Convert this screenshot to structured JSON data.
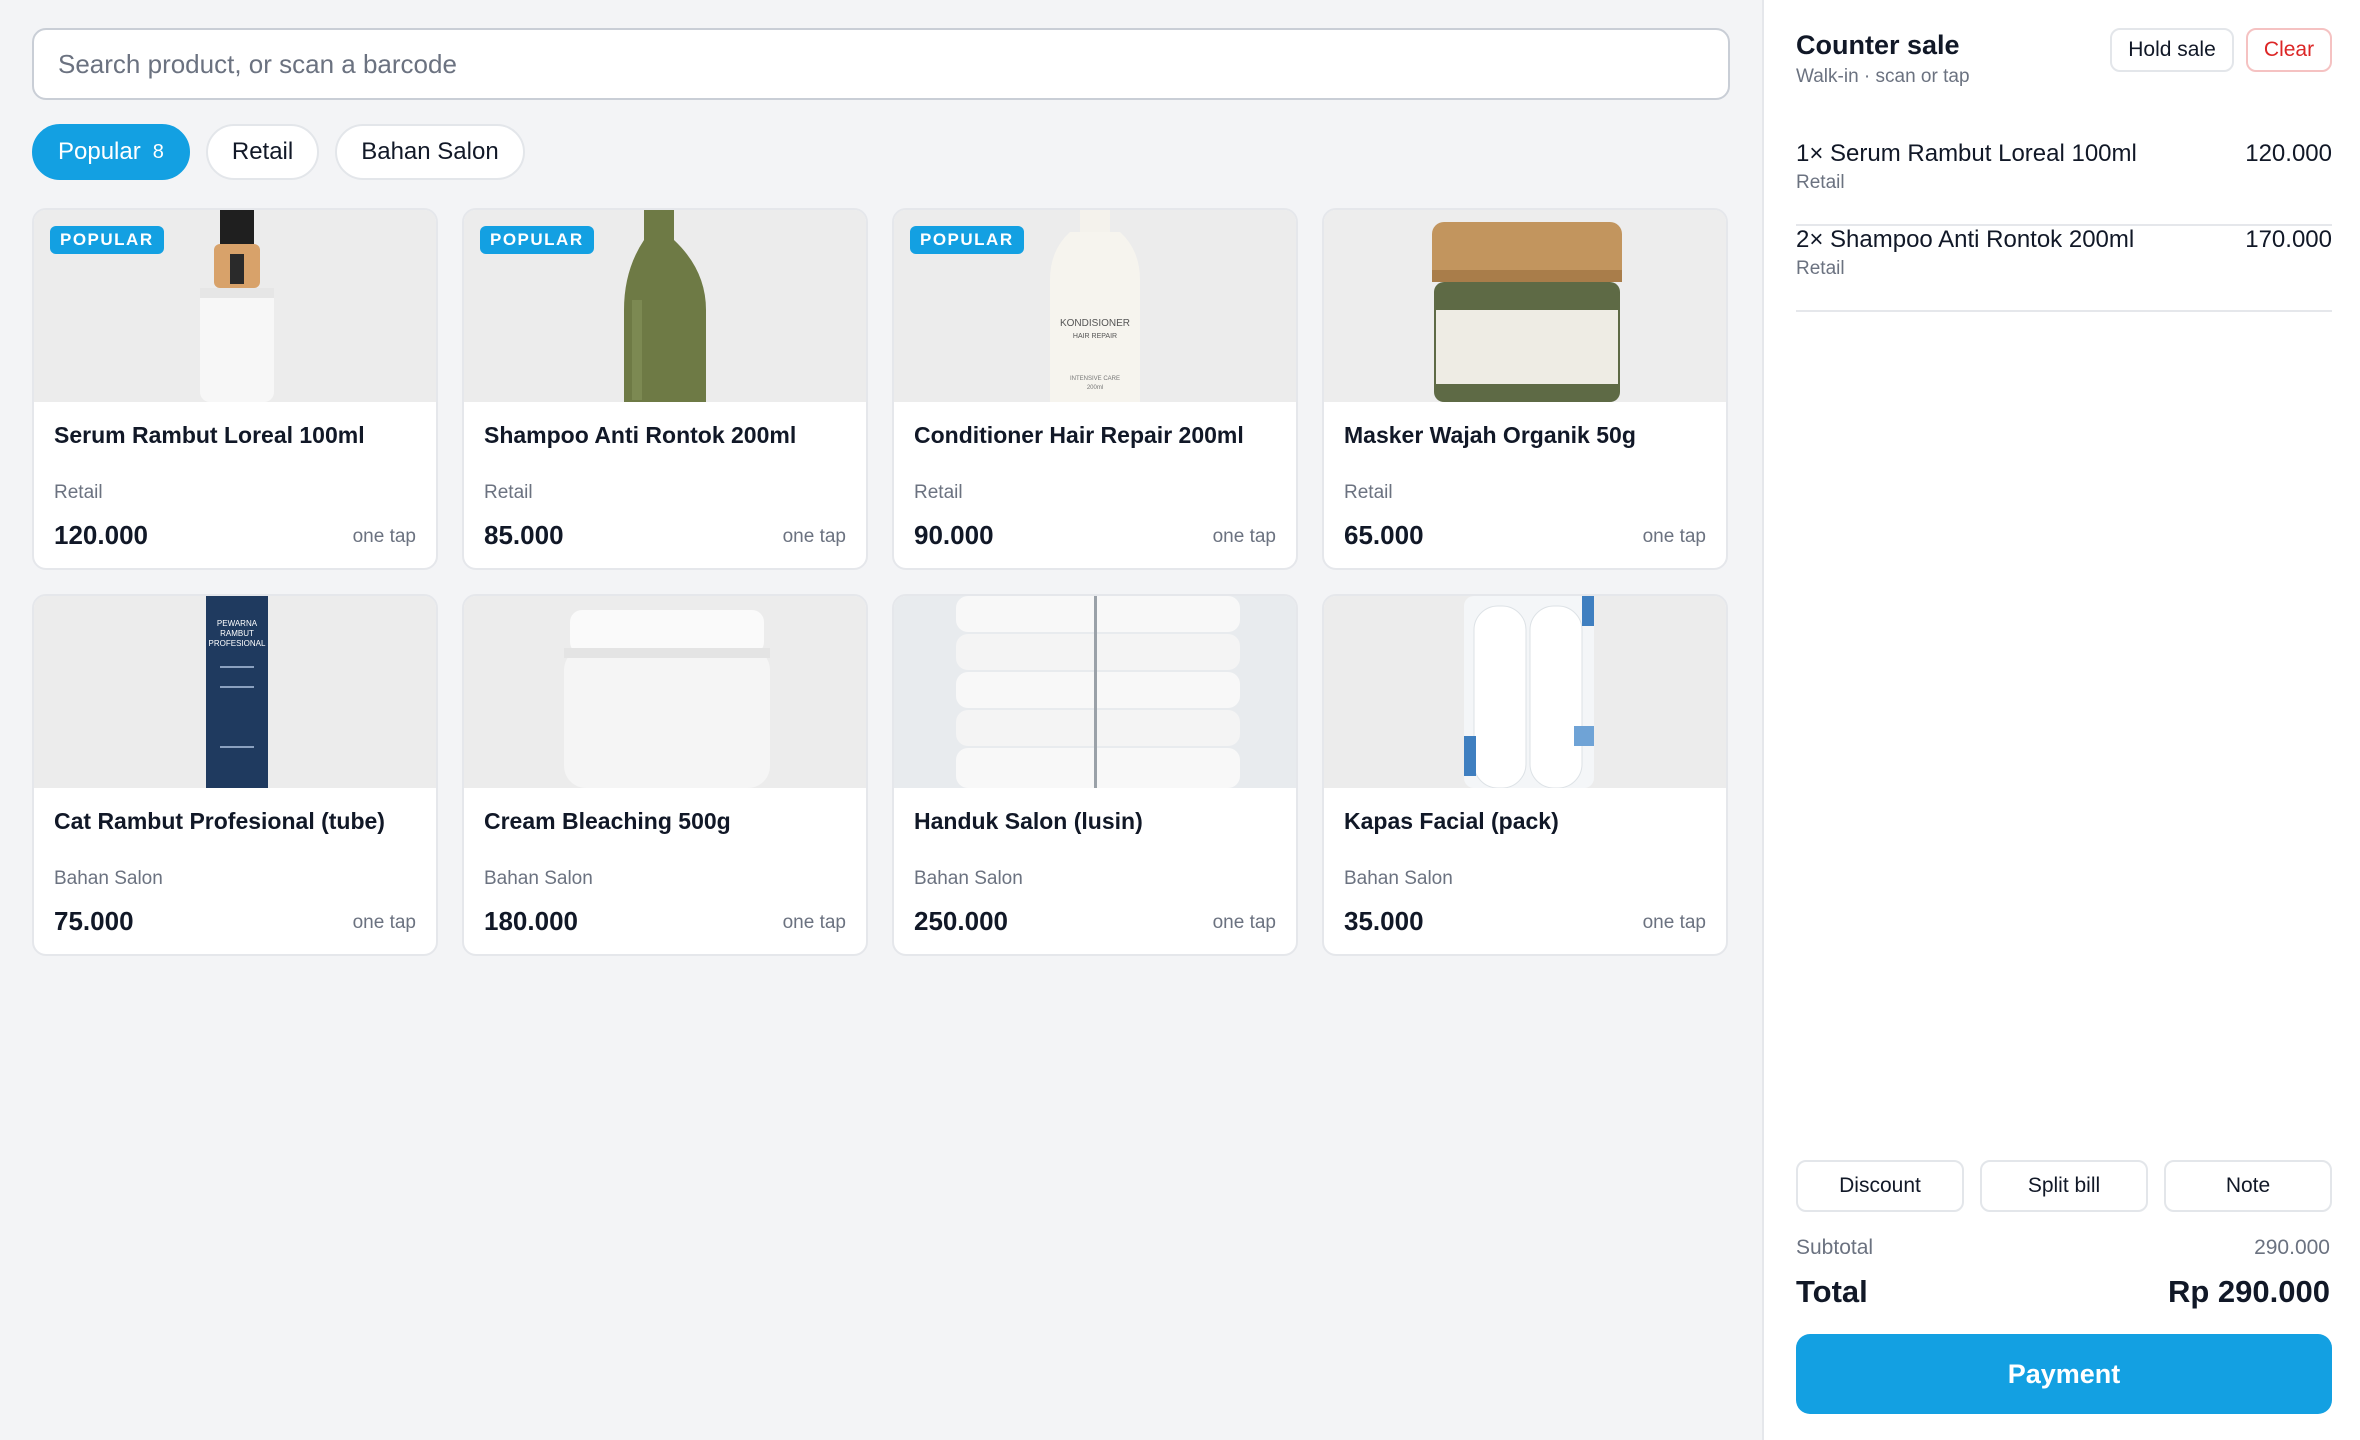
{
  "search": {
    "placeholder": "Search product, or scan a barcode"
  },
  "filters": [
    {
      "label": "Popular",
      "count": "8",
      "active": true
    },
    {
      "label": "Retail",
      "active": false
    },
    {
      "label": "Bahan Salon",
      "active": false
    }
  ],
  "products": [
    {
      "badge": "POPULAR",
      "name": "Serum Rambut Loreal 100ml",
      "category": "Retail",
      "price": "120.000",
      "tap": "one tap",
      "image": "serum-bottle"
    },
    {
      "badge": "POPULAR",
      "name": "Shampoo Anti Rontok 200ml",
      "category": "Retail",
      "price": "85.000",
      "tap": "one tap",
      "image": "shampoo-bottle"
    },
    {
      "badge": "POPULAR",
      "name": "Conditioner Hair Repair 200ml",
      "category": "Retail",
      "price": "90.000",
      "tap": "one tap",
      "image": "conditioner-bottle",
      "image_text": [
        "KONDISIONER",
        "HAIR REPAIR",
        "INTENSIVE CARE",
        "200ml"
      ]
    },
    {
      "badge": "",
      "name": "Masker Wajah Organik 50g",
      "category": "Retail",
      "price": "65.000",
      "tap": "one tap",
      "image": "mask-jar"
    },
    {
      "badge": "",
      "name": "Cat Rambut Profesional (tube)",
      "category": "Bahan Salon",
      "price": "75.000",
      "tap": "one tap",
      "image": "hair-dye-tube",
      "image_text": [
        "PEWARNA",
        "RAMBUT",
        "PROFESIONAL"
      ]
    },
    {
      "badge": "",
      "name": "Cream Bleaching 500g",
      "category": "Bahan Salon",
      "price": "180.000",
      "tap": "one tap",
      "image": "cream-tub"
    },
    {
      "badge": "",
      "name": "Handuk Salon (lusin)",
      "category": "Bahan Salon",
      "price": "250.000",
      "tap": "one tap",
      "image": "towel-stack"
    },
    {
      "badge": "",
      "name": "Kapas Facial (pack)",
      "category": "Bahan Salon",
      "price": "35.000",
      "tap": "one tap",
      "image": "cotton-pack"
    }
  ],
  "cart": {
    "title": "Counter sale",
    "subtitle": "Walk-in · scan or tap",
    "hold_label": "Hold sale",
    "clear_label": "Clear",
    "items": [
      {
        "name": "1× Serum Rambut Loreal 100ml",
        "category": "Retail",
        "amount": "120.000"
      },
      {
        "name": "2× Shampoo Anti Rontok 200ml",
        "category": "Retail",
        "amount": "170.000"
      }
    ],
    "actions": [
      "Discount",
      "Split bill",
      "Note"
    ],
    "subtotal_label": "Subtotal",
    "subtotal_value": "290.000",
    "total_label": "Total",
    "total_value": "Rp 290.000",
    "pay_label": "Payment"
  },
  "colors": {
    "accent": "#13a0e2",
    "danger": "#dc2626",
    "muted": "#6b7280"
  }
}
